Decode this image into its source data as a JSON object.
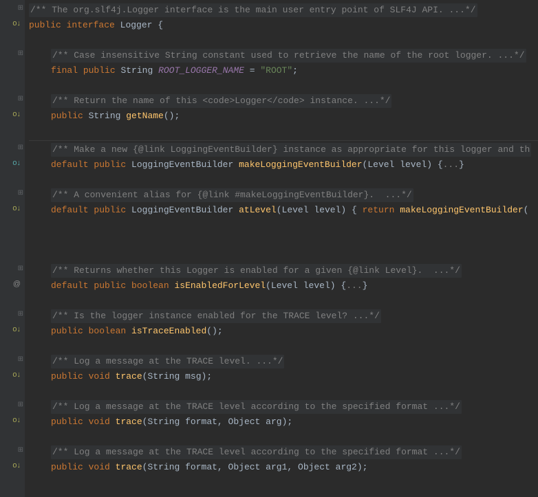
{
  "lines": [
    {
      "type": "doc",
      "indent": 0,
      "text": "/** The org.slf4j.Logger interface is the main user entry point of SLF4J API. ...*/",
      "marker": "fold"
    },
    {
      "type": "code",
      "indent": 0,
      "marker": "override-yellow",
      "tokens": [
        {
          "cls": "kw",
          "t": "public"
        },
        {
          "cls": "",
          "t": " "
        },
        {
          "cls": "kw",
          "t": "interface"
        },
        {
          "cls": "",
          "t": " "
        },
        {
          "cls": "classname",
          "t": "Logger"
        },
        {
          "cls": "",
          "t": " "
        },
        {
          "cls": "punct",
          "t": "{"
        }
      ]
    },
    {
      "type": "blank"
    },
    {
      "type": "doc",
      "indent": 1,
      "text": "/** Case insensitive String constant used to retrieve the name of the root logger. ...*/",
      "marker": "fold"
    },
    {
      "type": "code",
      "indent": 1,
      "tokens": [
        {
          "cls": "kw",
          "t": "final"
        },
        {
          "cls": "",
          "t": " "
        },
        {
          "cls": "kw",
          "t": "public"
        },
        {
          "cls": "",
          "t": " "
        },
        {
          "cls": "type",
          "t": "String"
        },
        {
          "cls": "",
          "t": " "
        },
        {
          "cls": "field-italic",
          "t": "ROOT_LOGGER_NAME"
        },
        {
          "cls": "",
          "t": " "
        },
        {
          "cls": "punct",
          "t": "="
        },
        {
          "cls": "",
          "t": " "
        },
        {
          "cls": "str",
          "t": "\"ROOT\""
        },
        {
          "cls": "punct",
          "t": ";"
        }
      ]
    },
    {
      "type": "blank"
    },
    {
      "type": "doc",
      "indent": 1,
      "text": "/** Return the name of this <code>Logger</code> instance. ...*/",
      "marker": "fold"
    },
    {
      "type": "code",
      "indent": 1,
      "marker": "override-yellow",
      "tokens": [
        {
          "cls": "kw",
          "t": "public"
        },
        {
          "cls": "",
          "t": " "
        },
        {
          "cls": "type",
          "t": "String"
        },
        {
          "cls": "",
          "t": " "
        },
        {
          "cls": "method",
          "t": "getName"
        },
        {
          "cls": "paren",
          "t": "()"
        },
        {
          "cls": "punct",
          "t": ";"
        }
      ]
    },
    {
      "type": "blank"
    },
    {
      "type": "sep"
    },
    {
      "type": "doc",
      "indent": 1,
      "text": "/** Make a new {@link LoggingEventBuilder} instance as appropriate for this logger and th",
      "marker": "fold"
    },
    {
      "type": "code",
      "indent": 1,
      "marker": "override",
      "tokens": [
        {
          "cls": "kw",
          "t": "default"
        },
        {
          "cls": "",
          "t": " "
        },
        {
          "cls": "kw",
          "t": "public"
        },
        {
          "cls": "",
          "t": " "
        },
        {
          "cls": "type",
          "t": "LoggingEventBuilder"
        },
        {
          "cls": "",
          "t": " "
        },
        {
          "cls": "method",
          "t": "makeLoggingEventBuilder"
        },
        {
          "cls": "paren",
          "t": "("
        },
        {
          "cls": "type",
          "t": "Level"
        },
        {
          "cls": "",
          "t": " "
        },
        {
          "cls": "param",
          "t": "level"
        },
        {
          "cls": "paren",
          "t": ")"
        },
        {
          "cls": "",
          "t": " "
        },
        {
          "cls": "punct",
          "t": "{"
        },
        {
          "cls": "fold-reg",
          "t": "..."
        },
        {
          "cls": "punct",
          "t": "}"
        }
      ]
    },
    {
      "type": "blank"
    },
    {
      "type": "doc",
      "indent": 1,
      "text": "/** A convenient alias for {@link #makeLoggingEventBuilder}.  ...*/",
      "marker": "fold"
    },
    {
      "type": "code",
      "indent": 1,
      "marker": "override-yellow",
      "tokens": [
        {
          "cls": "kw",
          "t": "default"
        },
        {
          "cls": "",
          "t": " "
        },
        {
          "cls": "kw",
          "t": "public"
        },
        {
          "cls": "",
          "t": " "
        },
        {
          "cls": "type",
          "t": "LoggingEventBuilder"
        },
        {
          "cls": "",
          "t": " "
        },
        {
          "cls": "method",
          "t": "atLevel"
        },
        {
          "cls": "paren",
          "t": "("
        },
        {
          "cls": "type",
          "t": "Level"
        },
        {
          "cls": "",
          "t": " "
        },
        {
          "cls": "param",
          "t": "level"
        },
        {
          "cls": "paren",
          "t": ")"
        },
        {
          "cls": "",
          "t": " "
        },
        {
          "cls": "punct",
          "t": "{"
        },
        {
          "cls": "",
          "t": " "
        },
        {
          "cls": "kw",
          "t": "return"
        },
        {
          "cls": "",
          "t": " "
        },
        {
          "cls": "method",
          "t": "makeLoggingEventBuilder"
        },
        {
          "cls": "paren",
          "t": "("
        }
      ]
    },
    {
      "type": "blank"
    },
    {
      "type": "blank"
    },
    {
      "type": "blank"
    },
    {
      "type": "doc",
      "indent": 1,
      "text": "/** Returns whether this Logger is enabled for a given {@link Level}.  ...*/",
      "marker": "fold"
    },
    {
      "type": "code",
      "indent": 1,
      "marker": "at",
      "tokens": [
        {
          "cls": "kw",
          "t": "default"
        },
        {
          "cls": "",
          "t": " "
        },
        {
          "cls": "kw",
          "t": "public"
        },
        {
          "cls": "",
          "t": " "
        },
        {
          "cls": "kw",
          "t": "boolean"
        },
        {
          "cls": "",
          "t": " "
        },
        {
          "cls": "method",
          "t": "isEnabledForLevel"
        },
        {
          "cls": "paren",
          "t": "("
        },
        {
          "cls": "type",
          "t": "Level"
        },
        {
          "cls": "",
          "t": " "
        },
        {
          "cls": "param",
          "t": "level"
        },
        {
          "cls": "paren",
          "t": ")"
        },
        {
          "cls": "",
          "t": " "
        },
        {
          "cls": "punct",
          "t": "{"
        },
        {
          "cls": "fold-reg",
          "t": "..."
        },
        {
          "cls": "punct",
          "t": "}"
        }
      ]
    },
    {
      "type": "blank"
    },
    {
      "type": "doc",
      "indent": 1,
      "text": "/** Is the logger instance enabled for the TRACE level? ...*/",
      "marker": "fold"
    },
    {
      "type": "code",
      "indent": 1,
      "marker": "override-yellow",
      "tokens": [
        {
          "cls": "kw",
          "t": "public"
        },
        {
          "cls": "",
          "t": " "
        },
        {
          "cls": "kw",
          "t": "boolean"
        },
        {
          "cls": "",
          "t": " "
        },
        {
          "cls": "method",
          "t": "isTraceEnabled"
        },
        {
          "cls": "paren",
          "t": "()"
        },
        {
          "cls": "punct",
          "t": ";"
        }
      ]
    },
    {
      "type": "blank"
    },
    {
      "type": "doc",
      "indent": 1,
      "text": "/** Log a message at the TRACE level. ...*/",
      "marker": "fold"
    },
    {
      "type": "code",
      "indent": 1,
      "marker": "override-yellow",
      "tokens": [
        {
          "cls": "kw",
          "t": "public"
        },
        {
          "cls": "",
          "t": " "
        },
        {
          "cls": "kw",
          "t": "void"
        },
        {
          "cls": "",
          "t": " "
        },
        {
          "cls": "method",
          "t": "trace"
        },
        {
          "cls": "paren",
          "t": "("
        },
        {
          "cls": "type",
          "t": "String"
        },
        {
          "cls": "",
          "t": " "
        },
        {
          "cls": "param",
          "t": "msg"
        },
        {
          "cls": "paren",
          "t": ")"
        },
        {
          "cls": "punct",
          "t": ";"
        }
      ]
    },
    {
      "type": "blank"
    },
    {
      "type": "doc",
      "indent": 1,
      "text": "/** Log a message at the TRACE level according to the specified format ...*/",
      "marker": "fold"
    },
    {
      "type": "code",
      "indent": 1,
      "marker": "override-yellow",
      "tokens": [
        {
          "cls": "kw",
          "t": "public"
        },
        {
          "cls": "",
          "t": " "
        },
        {
          "cls": "kw",
          "t": "void"
        },
        {
          "cls": "",
          "t": " "
        },
        {
          "cls": "method",
          "t": "trace"
        },
        {
          "cls": "paren",
          "t": "("
        },
        {
          "cls": "type",
          "t": "String"
        },
        {
          "cls": "",
          "t": " "
        },
        {
          "cls": "param",
          "t": "format"
        },
        {
          "cls": "punct",
          "t": ","
        },
        {
          "cls": "",
          "t": " "
        },
        {
          "cls": "type",
          "t": "Object"
        },
        {
          "cls": "",
          "t": " "
        },
        {
          "cls": "param",
          "t": "arg"
        },
        {
          "cls": "paren",
          "t": ")"
        },
        {
          "cls": "punct",
          "t": ";"
        }
      ]
    },
    {
      "type": "blank"
    },
    {
      "type": "doc",
      "indent": 1,
      "text": "/** Log a message at the TRACE level according to the specified format ...*/",
      "marker": "fold"
    },
    {
      "type": "code",
      "indent": 1,
      "marker": "override-yellow",
      "tokens": [
        {
          "cls": "kw",
          "t": "public"
        },
        {
          "cls": "",
          "t": " "
        },
        {
          "cls": "kw",
          "t": "void"
        },
        {
          "cls": "",
          "t": " "
        },
        {
          "cls": "method",
          "t": "trace"
        },
        {
          "cls": "paren",
          "t": "("
        },
        {
          "cls": "type",
          "t": "String"
        },
        {
          "cls": "",
          "t": " "
        },
        {
          "cls": "param",
          "t": "format"
        },
        {
          "cls": "punct",
          "t": ","
        },
        {
          "cls": "",
          "t": " "
        },
        {
          "cls": "type",
          "t": "Object"
        },
        {
          "cls": "",
          "t": " "
        },
        {
          "cls": "param",
          "t": "arg1"
        },
        {
          "cls": "punct",
          "t": ","
        },
        {
          "cls": "",
          "t": " "
        },
        {
          "cls": "type",
          "t": "Object"
        },
        {
          "cls": "",
          "t": " "
        },
        {
          "cls": "param",
          "t": "arg2"
        },
        {
          "cls": "paren",
          "t": ")"
        },
        {
          "cls": "punct",
          "t": ";"
        }
      ]
    },
    {
      "type": "blank"
    }
  ]
}
